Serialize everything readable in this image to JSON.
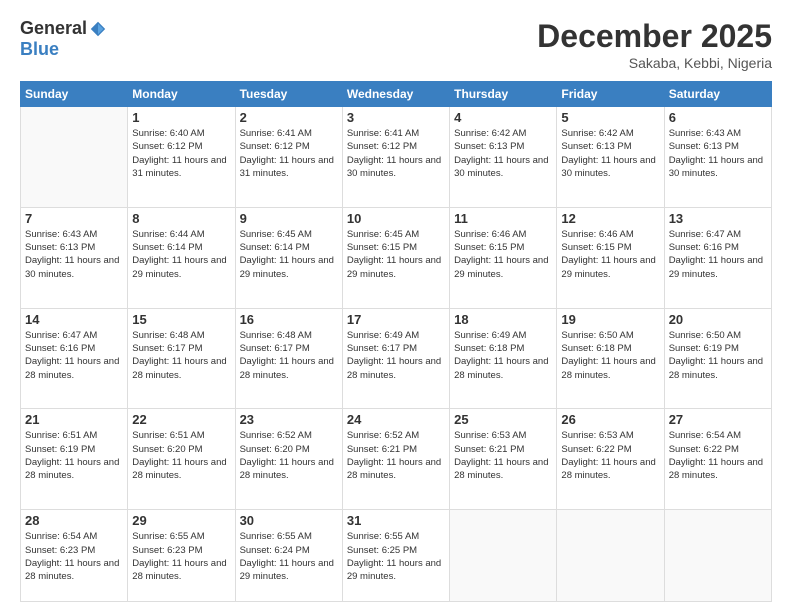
{
  "logo": {
    "general": "General",
    "blue": "Blue"
  },
  "title": "December 2025",
  "location": "Sakaba, Kebbi, Nigeria",
  "headers": [
    "Sunday",
    "Monday",
    "Tuesday",
    "Wednesday",
    "Thursday",
    "Friday",
    "Saturday"
  ],
  "weeks": [
    [
      {
        "day": "",
        "sunrise": "",
        "sunset": "",
        "daylight": ""
      },
      {
        "day": "1",
        "sunrise": "Sunrise: 6:40 AM",
        "sunset": "Sunset: 6:12 PM",
        "daylight": "Daylight: 11 hours and 31 minutes."
      },
      {
        "day": "2",
        "sunrise": "Sunrise: 6:41 AM",
        "sunset": "Sunset: 6:12 PM",
        "daylight": "Daylight: 11 hours and 31 minutes."
      },
      {
        "day": "3",
        "sunrise": "Sunrise: 6:41 AM",
        "sunset": "Sunset: 6:12 PM",
        "daylight": "Daylight: 11 hours and 30 minutes."
      },
      {
        "day": "4",
        "sunrise": "Sunrise: 6:42 AM",
        "sunset": "Sunset: 6:13 PM",
        "daylight": "Daylight: 11 hours and 30 minutes."
      },
      {
        "day": "5",
        "sunrise": "Sunrise: 6:42 AM",
        "sunset": "Sunset: 6:13 PM",
        "daylight": "Daylight: 11 hours and 30 minutes."
      },
      {
        "day": "6",
        "sunrise": "Sunrise: 6:43 AM",
        "sunset": "Sunset: 6:13 PM",
        "daylight": "Daylight: 11 hours and 30 minutes."
      }
    ],
    [
      {
        "day": "7",
        "sunrise": "Sunrise: 6:43 AM",
        "sunset": "Sunset: 6:13 PM",
        "daylight": "Daylight: 11 hours and 30 minutes."
      },
      {
        "day": "8",
        "sunrise": "Sunrise: 6:44 AM",
        "sunset": "Sunset: 6:14 PM",
        "daylight": "Daylight: 11 hours and 29 minutes."
      },
      {
        "day": "9",
        "sunrise": "Sunrise: 6:45 AM",
        "sunset": "Sunset: 6:14 PM",
        "daylight": "Daylight: 11 hours and 29 minutes."
      },
      {
        "day": "10",
        "sunrise": "Sunrise: 6:45 AM",
        "sunset": "Sunset: 6:15 PM",
        "daylight": "Daylight: 11 hours and 29 minutes."
      },
      {
        "day": "11",
        "sunrise": "Sunrise: 6:46 AM",
        "sunset": "Sunset: 6:15 PM",
        "daylight": "Daylight: 11 hours and 29 minutes."
      },
      {
        "day": "12",
        "sunrise": "Sunrise: 6:46 AM",
        "sunset": "Sunset: 6:15 PM",
        "daylight": "Daylight: 11 hours and 29 minutes."
      },
      {
        "day": "13",
        "sunrise": "Sunrise: 6:47 AM",
        "sunset": "Sunset: 6:16 PM",
        "daylight": "Daylight: 11 hours and 29 minutes."
      }
    ],
    [
      {
        "day": "14",
        "sunrise": "Sunrise: 6:47 AM",
        "sunset": "Sunset: 6:16 PM",
        "daylight": "Daylight: 11 hours and 28 minutes."
      },
      {
        "day": "15",
        "sunrise": "Sunrise: 6:48 AM",
        "sunset": "Sunset: 6:17 PM",
        "daylight": "Daylight: 11 hours and 28 minutes."
      },
      {
        "day": "16",
        "sunrise": "Sunrise: 6:48 AM",
        "sunset": "Sunset: 6:17 PM",
        "daylight": "Daylight: 11 hours and 28 minutes."
      },
      {
        "day": "17",
        "sunrise": "Sunrise: 6:49 AM",
        "sunset": "Sunset: 6:17 PM",
        "daylight": "Daylight: 11 hours and 28 minutes."
      },
      {
        "day": "18",
        "sunrise": "Sunrise: 6:49 AM",
        "sunset": "Sunset: 6:18 PM",
        "daylight": "Daylight: 11 hours and 28 minutes."
      },
      {
        "day": "19",
        "sunrise": "Sunrise: 6:50 AM",
        "sunset": "Sunset: 6:18 PM",
        "daylight": "Daylight: 11 hours and 28 minutes."
      },
      {
        "day": "20",
        "sunrise": "Sunrise: 6:50 AM",
        "sunset": "Sunset: 6:19 PM",
        "daylight": "Daylight: 11 hours and 28 minutes."
      }
    ],
    [
      {
        "day": "21",
        "sunrise": "Sunrise: 6:51 AM",
        "sunset": "Sunset: 6:19 PM",
        "daylight": "Daylight: 11 hours and 28 minutes."
      },
      {
        "day": "22",
        "sunrise": "Sunrise: 6:51 AM",
        "sunset": "Sunset: 6:20 PM",
        "daylight": "Daylight: 11 hours and 28 minutes."
      },
      {
        "day": "23",
        "sunrise": "Sunrise: 6:52 AM",
        "sunset": "Sunset: 6:20 PM",
        "daylight": "Daylight: 11 hours and 28 minutes."
      },
      {
        "day": "24",
        "sunrise": "Sunrise: 6:52 AM",
        "sunset": "Sunset: 6:21 PM",
        "daylight": "Daylight: 11 hours and 28 minutes."
      },
      {
        "day": "25",
        "sunrise": "Sunrise: 6:53 AM",
        "sunset": "Sunset: 6:21 PM",
        "daylight": "Daylight: 11 hours and 28 minutes."
      },
      {
        "day": "26",
        "sunrise": "Sunrise: 6:53 AM",
        "sunset": "Sunset: 6:22 PM",
        "daylight": "Daylight: 11 hours and 28 minutes."
      },
      {
        "day": "27",
        "sunrise": "Sunrise: 6:54 AM",
        "sunset": "Sunset: 6:22 PM",
        "daylight": "Daylight: 11 hours and 28 minutes."
      }
    ],
    [
      {
        "day": "28",
        "sunrise": "Sunrise: 6:54 AM",
        "sunset": "Sunset: 6:23 PM",
        "daylight": "Daylight: 11 hours and 28 minutes."
      },
      {
        "day": "29",
        "sunrise": "Sunrise: 6:55 AM",
        "sunset": "Sunset: 6:23 PM",
        "daylight": "Daylight: 11 hours and 28 minutes."
      },
      {
        "day": "30",
        "sunrise": "Sunrise: 6:55 AM",
        "sunset": "Sunset: 6:24 PM",
        "daylight": "Daylight: 11 hours and 29 minutes."
      },
      {
        "day": "31",
        "sunrise": "Sunrise: 6:55 AM",
        "sunset": "Sunset: 6:25 PM",
        "daylight": "Daylight: 11 hours and 29 minutes."
      },
      {
        "day": "",
        "sunrise": "",
        "sunset": "",
        "daylight": ""
      },
      {
        "day": "",
        "sunrise": "",
        "sunset": "",
        "daylight": ""
      },
      {
        "day": "",
        "sunrise": "",
        "sunset": "",
        "daylight": ""
      }
    ]
  ]
}
